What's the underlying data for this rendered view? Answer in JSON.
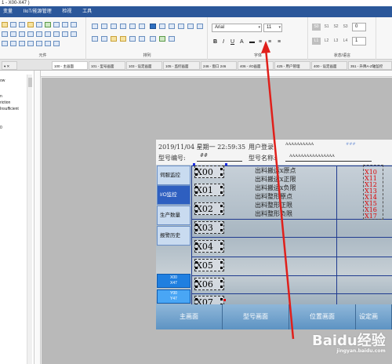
{
  "window": {
    "title": "1 - X00-X47 )"
  },
  "menubar": {
    "items": [
      "变量",
      "IIoT/能源管理",
      "检视",
      "工具"
    ]
  },
  "ribbon": {
    "group_component": "元件",
    "group_arrange": "排列",
    "group_font": "字体",
    "group_state": "状态/语言",
    "font_name": "Arial",
    "font_size": "11",
    "state_buttons": [
      "S0",
      "S1",
      "S2",
      "S3"
    ],
    "state_value": "0",
    "lang_buttons": [
      "L1",
      "L2",
      "L3",
      "L4"
    ],
    "lang_value": "1"
  },
  "tabs": [
    {
      "label": "100 - 主画面",
      "active": true
    },
    {
      "label": "101 - 型号画面"
    },
    {
      "label": "103 - 设定画面"
    },
    {
      "label": "105 - 监控画面"
    },
    {
      "label": "246 - 窗口 246"
    },
    {
      "label": "406 - I/O画面"
    },
    {
      "label": "425 - 用户管理"
    },
    {
      "label": "400 - 设定画面"
    },
    {
      "label": "351 - 升降A-Z轴监控"
    }
  ],
  "left_panel": {
    "lines": [
      "ow",
      "n",
      "riction",
      "Insufficient",
      "0"
    ]
  },
  "screen": {
    "datetime": "2019/11/04  星期一 22:59:35",
    "user_login_label": "用户登录:",
    "user_login_value": "AAAAAAAAAA",
    "model_no_label": "型号编号:",
    "model_no_value": "##",
    "model_name_label": "型号名称:",
    "model_name_value": "AAAAAAAAAAAAAAAA",
    "top_right_value": "###",
    "nav": [
      "伺服监控",
      "I/O监控",
      "生产数量",
      "报警历史"
    ],
    "nav_active_index": 1,
    "x_buttons": [
      {
        "line1": "X00",
        "line2": "X47"
      },
      {
        "line1": "Y00",
        "line2": "Y47"
      }
    ],
    "x_inputs": [
      "X00",
      "X01",
      "X02",
      "X03",
      "X04",
      "X05",
      "X06",
      "X07"
    ],
    "descriptions": [
      "出料搬运x原点",
      "出料搬运x正限",
      "出料搬运x负限",
      "出料整形原点",
      "出料整形正限",
      "出料整形负限"
    ],
    "red_labels": [
      "X10",
      "X11",
      "X12",
      "X13",
      "X14",
      "X15",
      "X16",
      "X17"
    ],
    "bottom_nav": [
      "主画面",
      "型号画面",
      "位置画面",
      "设定画"
    ]
  },
  "watermark": {
    "text": "Baidu经验",
    "sub": "jingyan.baidu.com"
  }
}
